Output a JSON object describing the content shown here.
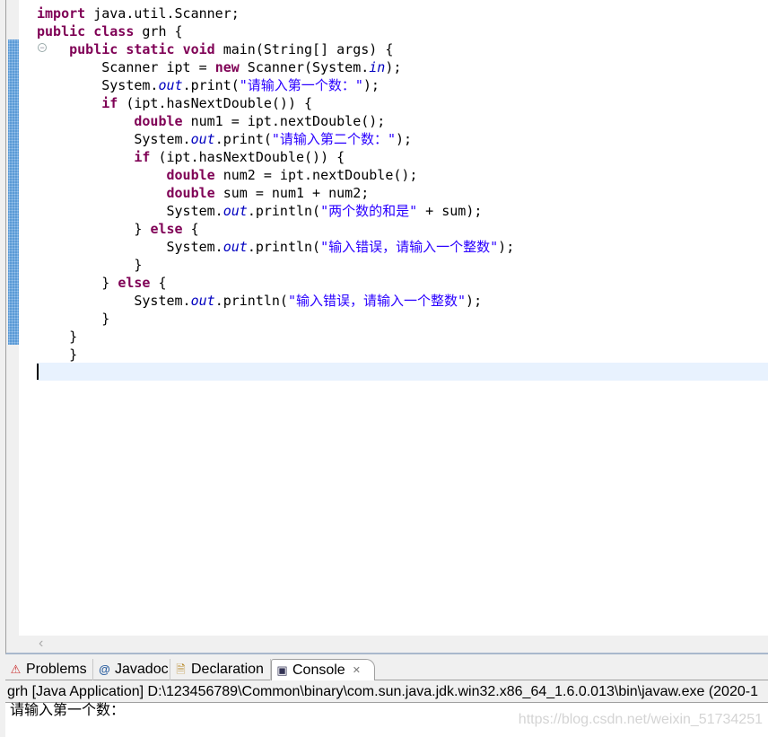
{
  "editor": {
    "lines": [
      [
        [
          "k",
          "import"
        ],
        [
          "t",
          " java.util.Scanner;"
        ]
      ],
      [
        [
          "k",
          "public"
        ],
        [
          "t",
          " "
        ],
        [
          "k",
          "class"
        ],
        [
          "t",
          " grh {"
        ]
      ],
      [
        [
          "t",
          "    "
        ],
        [
          "k",
          "public"
        ],
        [
          "t",
          " "
        ],
        [
          "k",
          "static"
        ],
        [
          "t",
          " "
        ],
        [
          "k",
          "void"
        ],
        [
          "t",
          " main(String[] args) {"
        ]
      ],
      [
        [
          "t",
          "        Scanner ipt = "
        ],
        [
          "k",
          "new"
        ],
        [
          "t",
          " Scanner(System."
        ],
        [
          "f",
          "in"
        ],
        [
          "t",
          ");"
        ]
      ],
      [
        [
          "t",
          "        System."
        ],
        [
          "f",
          "out"
        ],
        [
          "t",
          ".print("
        ],
        [
          "s",
          "\"请输入第一个数：\""
        ],
        [
          "t",
          ");"
        ]
      ],
      [
        [
          "t",
          "        "
        ],
        [
          "k",
          "if"
        ],
        [
          "t",
          " (ipt.hasNextDouble()) {"
        ]
      ],
      [
        [
          "t",
          "            "
        ],
        [
          "k",
          "double"
        ],
        [
          "t",
          " num1 = ipt.nextDouble();"
        ]
      ],
      [
        [
          "t",
          "            System."
        ],
        [
          "f",
          "out"
        ],
        [
          "t",
          ".print("
        ],
        [
          "s",
          "\"请输入第二个数：\""
        ],
        [
          "t",
          ");"
        ]
      ],
      [
        [
          "t",
          "            "
        ],
        [
          "k",
          "if"
        ],
        [
          "t",
          " (ipt.hasNextDouble()) {"
        ]
      ],
      [
        [
          "t",
          "                "
        ],
        [
          "k",
          "double"
        ],
        [
          "t",
          " num2 = ipt.nextDouble();"
        ]
      ],
      [
        [
          "t",
          "                "
        ],
        [
          "k",
          "double"
        ],
        [
          "t",
          " sum = num1 + num2;"
        ]
      ],
      [
        [
          "t",
          "                System."
        ],
        [
          "f",
          "out"
        ],
        [
          "t",
          ".println("
        ],
        [
          "s",
          "\"两个数的和是\""
        ],
        [
          "t",
          " + sum);"
        ]
      ],
      [
        [
          "t",
          "            } "
        ],
        [
          "k",
          "else"
        ],
        [
          "t",
          " {"
        ]
      ],
      [
        [
          "t",
          "                System."
        ],
        [
          "f",
          "out"
        ],
        [
          "t",
          ".println("
        ],
        [
          "s",
          "\"输入错误，请输入一个整数\""
        ],
        [
          "t",
          ");"
        ]
      ],
      [
        [
          "t",
          "            }"
        ]
      ],
      [
        [
          "t",
          "        } "
        ],
        [
          "k",
          "else"
        ],
        [
          "t",
          " {"
        ]
      ],
      [
        [
          "t",
          "            System."
        ],
        [
          "f",
          "out"
        ],
        [
          "t",
          ".println("
        ],
        [
          "s",
          "\"输入错误，请输入一个整数\""
        ],
        [
          "t",
          ");"
        ]
      ],
      [
        [
          "t",
          "        }"
        ]
      ],
      [
        [
          "t",
          "    }"
        ]
      ],
      [
        [
          "t",
          "    }"
        ]
      ]
    ],
    "scroll_left": "‹"
  },
  "tabs": [
    {
      "label": "Problems",
      "icon": "problems-icon",
      "glyph": "⚠"
    },
    {
      "label": "Javadoc",
      "icon": "at-icon",
      "glyph": "@"
    },
    {
      "label": "Declaration",
      "icon": "declaration-icon",
      "glyph": "🗎"
    },
    {
      "label": "Console",
      "icon": "console-icon",
      "glyph": "▣",
      "active": true,
      "close": "✕"
    }
  ],
  "console": {
    "header": "grh [Java Application] D:\\123456789\\Common\\binary\\com.sun.java.jdk.win32.x86_64_1.6.0.013\\bin\\javaw.exe (2020-1",
    "output": "请输入第一个数：",
    "watermark": "https://blog.csdn.net/weixin_51734251"
  }
}
